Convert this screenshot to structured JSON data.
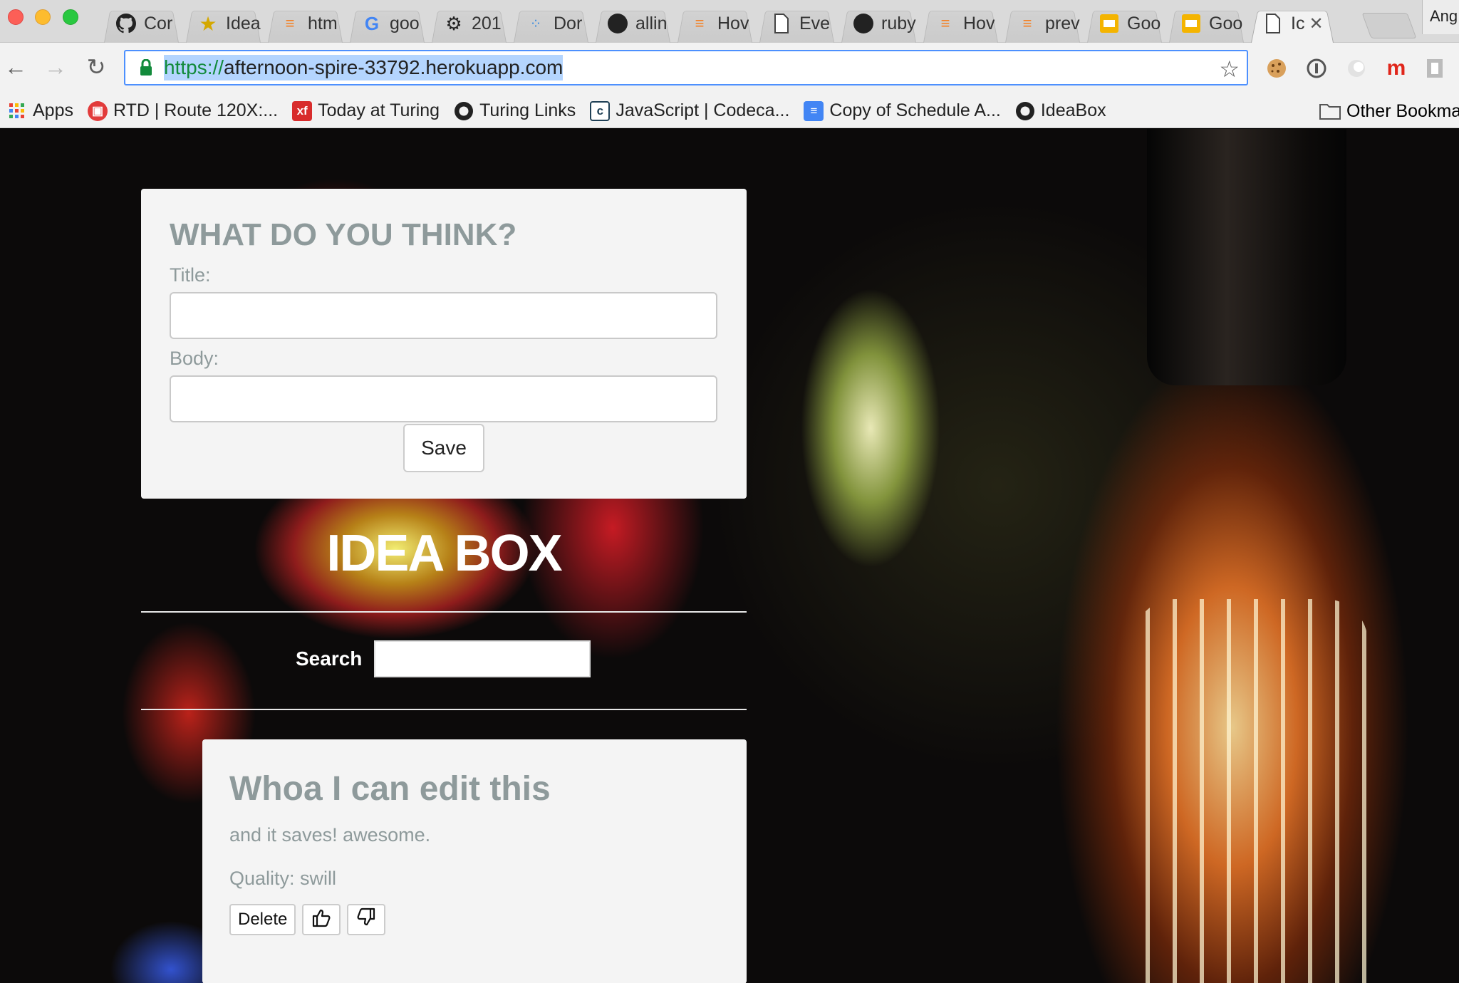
{
  "browser": {
    "tabs": [
      {
        "label": "Cor",
        "icon": "github-icon"
      },
      {
        "label": "Idea",
        "icon": "star-icon"
      },
      {
        "label": "htm",
        "icon": "stackoverflow-icon"
      },
      {
        "label": "goo",
        "icon": "google-icon"
      },
      {
        "label": "201",
        "icon": "gear-icon"
      },
      {
        "label": "Dor",
        "icon": "dots-icon"
      },
      {
        "label": "allin",
        "icon": "github-icon"
      },
      {
        "label": "Hov",
        "icon": "stackoverflow-icon"
      },
      {
        "label": "Eve",
        "icon": "page-icon"
      },
      {
        "label": "ruby",
        "icon": "github-icon"
      },
      {
        "label": "Hov",
        "icon": "stackoverflow-icon"
      },
      {
        "label": "prev",
        "icon": "stackoverflow-icon"
      },
      {
        "label": "Goo",
        "icon": "slides-icon"
      },
      {
        "label": "Goo",
        "icon": "slides-icon"
      },
      {
        "label": "Ic",
        "icon": "page-icon",
        "active": true
      }
    ],
    "profile_label": "Ang",
    "url_scheme": "https://",
    "url_host": "afternoon-spire-33792.herokuapp.com",
    "bookmarks": [
      {
        "label": "Apps",
        "icon": "apps-grid-icon"
      },
      {
        "label": "RTD | Route 120X:...",
        "icon": "bus-icon"
      },
      {
        "label": "Today at Turing",
        "icon": "xf-icon"
      },
      {
        "label": "Turing Links",
        "icon": "github-icon"
      },
      {
        "label": "JavaScript | Codeca...",
        "icon": "codecademy-icon"
      },
      {
        "label": "Copy of Schedule A...",
        "icon": "docs-icon"
      },
      {
        "label": "IdeaBox",
        "icon": "github-icon"
      }
    ],
    "other_bookmarks": "Other Bookma"
  },
  "form": {
    "heading": "WHAT DO YOU THINK?",
    "title_label": "Title:",
    "title_value": "",
    "body_label": "Body:",
    "body_value": "",
    "save_label": "Save"
  },
  "app_title": "IDEA BOX",
  "search": {
    "label": "Search",
    "value": ""
  },
  "idea": {
    "title": "Whoa I can edit this",
    "body": "and it saves! awesome.",
    "quality": "Quality: swill",
    "delete_label": "Delete",
    "upvote_icon": "thumbs-up-icon",
    "downvote_icon": "thumbs-down-icon"
  },
  "colors": {
    "card_bg": "#f4f4f4",
    "card_text": "#8e9a9b",
    "url_green": "#128a3b",
    "focus_blue": "#4d90fe"
  }
}
